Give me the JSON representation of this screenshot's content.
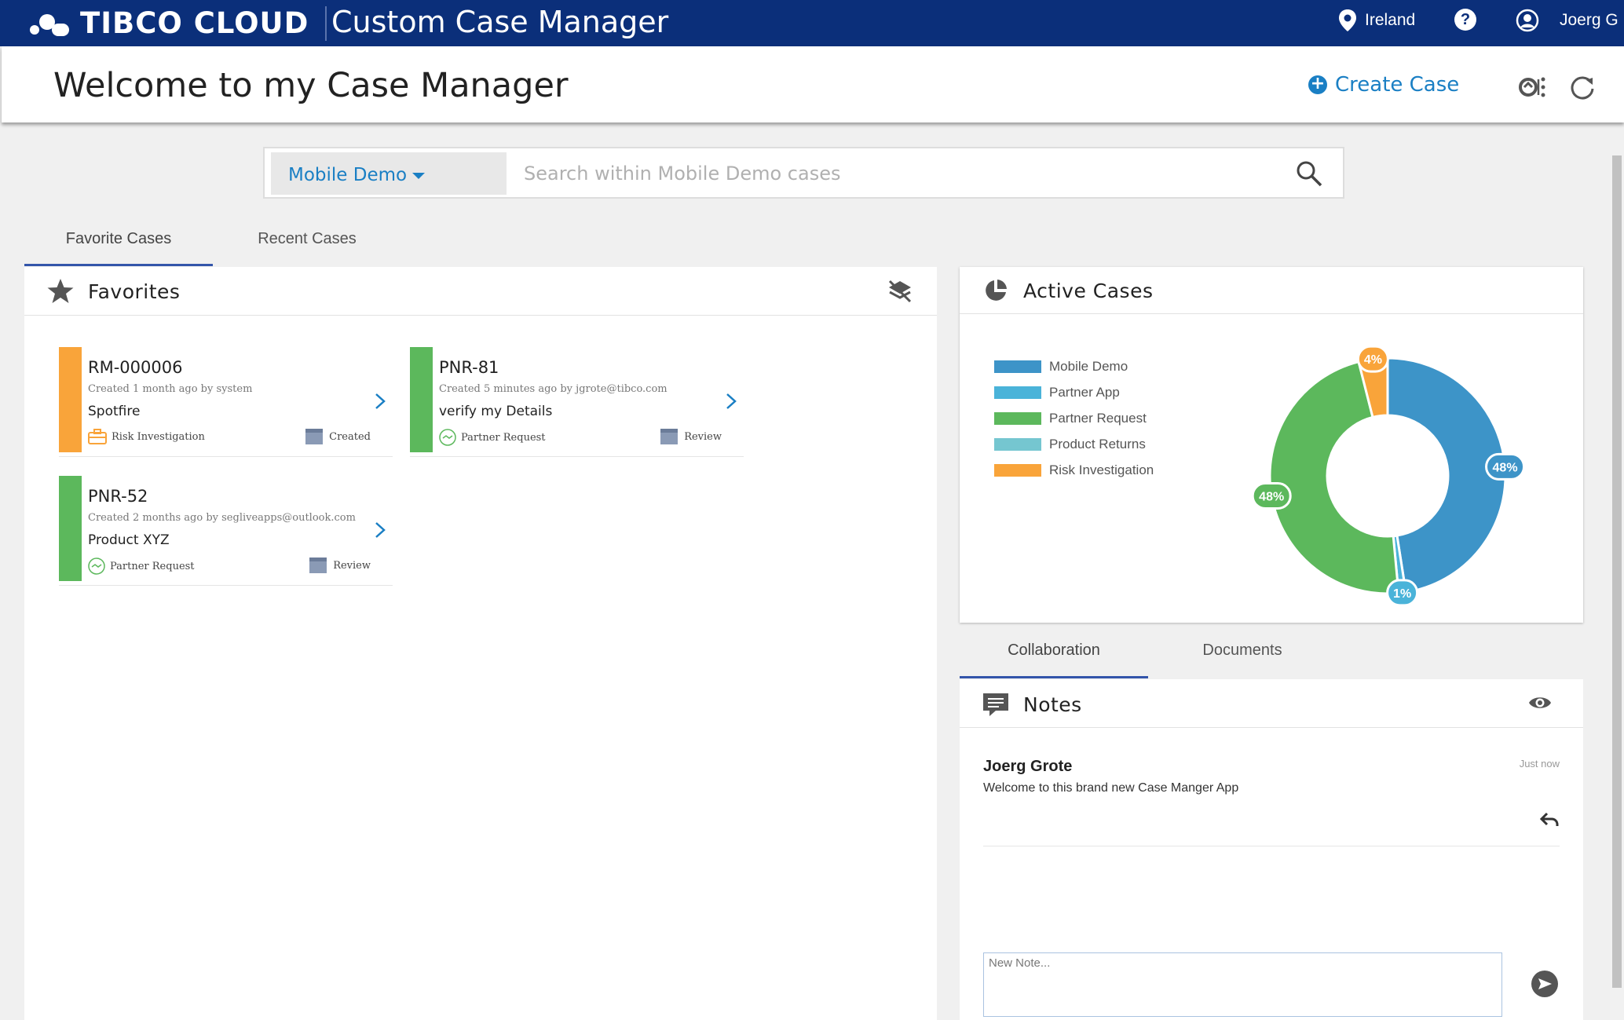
{
  "topbar": {
    "brand": "TIBCO CLOUD",
    "app_title": "Custom Case Manager",
    "region": "Ireland",
    "help": "?",
    "user": "Joerg G"
  },
  "header": {
    "title": "Welcome to my Case Manager",
    "create_case": "Create Case"
  },
  "search": {
    "selected_app": "Mobile Demo",
    "placeholder": "Search within Mobile Demo cases"
  },
  "left_tabs": [
    "Favorite Cases",
    "Recent Cases"
  ],
  "favorites": {
    "title": "Favorites",
    "cards": [
      {
        "id": "RM-000006",
        "meta": "Created 1 month ago by system",
        "summary": "Spotfire",
        "type": "Risk Investigation",
        "state": "Created",
        "color": "#f9a43a"
      },
      {
        "id": "PNR-81",
        "meta": "Created 5 minutes ago by jgrote@tibco.com",
        "summary": "verify my Details",
        "type": "Partner Request",
        "state": "Review",
        "color": "#5cb85c"
      },
      {
        "id": "PNR-52",
        "meta": "Created 2 months ago by segliveapps@outlook.com",
        "summary": "Product XYZ",
        "type": "Partner Request",
        "state": "Review",
        "color": "#5cb85c"
      }
    ]
  },
  "active_cases": {
    "title": "Active Cases",
    "chart_data": {
      "type": "pie",
      "title": "",
      "legend_position": "left",
      "categories": [
        "Mobile Demo",
        "Partner App",
        "Partner Request",
        "Product Returns",
        "Risk Investigation"
      ],
      "values": [
        48,
        1,
        48,
        0,
        4
      ],
      "labels": [
        "48%",
        "1%",
        "48%",
        "",
        "4%"
      ],
      "colors": [
        "#3d94c8",
        "#4ab3d9",
        "#5cb85c",
        "#75c6d0",
        "#f9a43a"
      ]
    }
  },
  "right_tabs": [
    "Collaboration",
    "Documents"
  ],
  "notes": {
    "title": "Notes",
    "items": [
      {
        "author": "Joerg Grote",
        "time": "Just now",
        "text": "Welcome to this brand new Case Manger App"
      }
    ],
    "new_note_placeholder": "New Note..."
  }
}
